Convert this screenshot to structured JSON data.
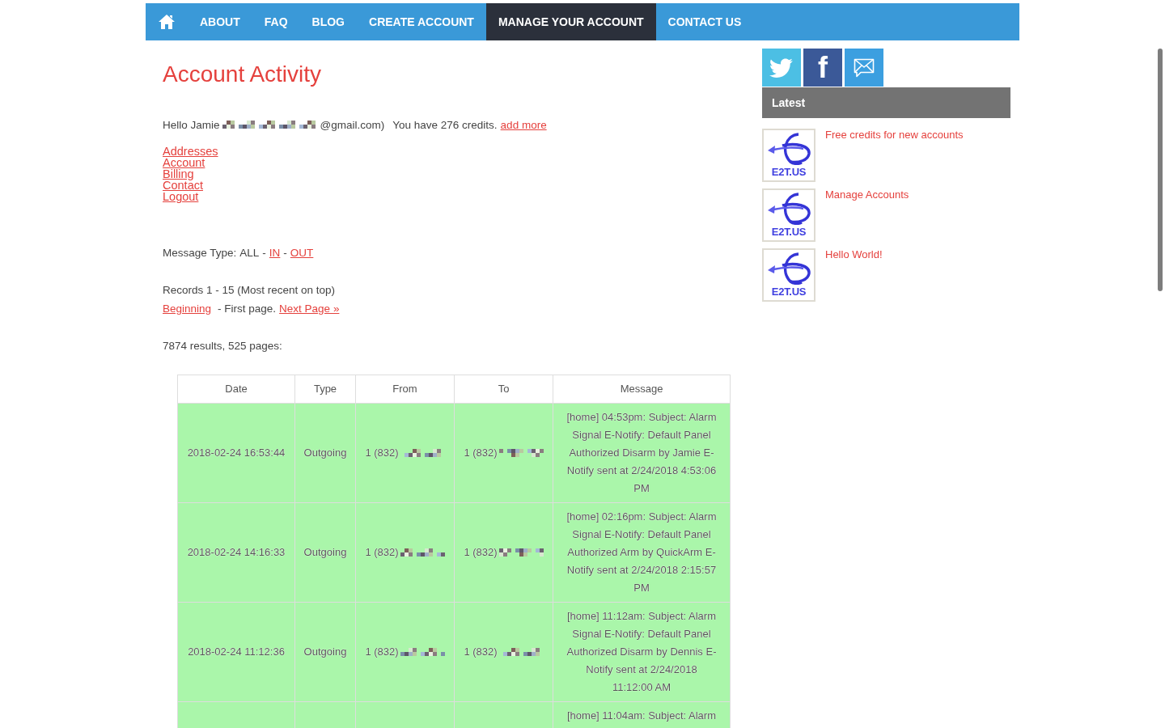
{
  "nav": {
    "items": [
      {
        "kind": "home",
        "selected": false
      },
      {
        "kind": "link",
        "label": "ABOUT",
        "selected": false
      },
      {
        "kind": "link",
        "label": "FAQ",
        "selected": false
      },
      {
        "kind": "link",
        "label": "BLOG",
        "selected": false
      },
      {
        "kind": "link",
        "label": "CREATE ACCOUNT",
        "selected": false
      },
      {
        "kind": "link",
        "label": "MANAGE YOUR ACCOUNT",
        "selected": true
      },
      {
        "kind": "link",
        "label": "CONTACT US",
        "selected": false
      }
    ]
  },
  "main": {
    "title": "Account Activity",
    "greeting": {
      "text": "Hello Jamie",
      "email_redacted": true,
      "email_end": "@gmail.com)",
      "credits": "You have 276 credits.",
      "add_link": "add more"
    },
    "account_links": [
      "Addresses",
      "Account",
      "Billing",
      "Contact",
      "Logout"
    ],
    "message_type": {
      "label": "Message Type:",
      "options": [
        {
          "label": "ALL",
          "selected": true
        },
        {
          "separator": "-",
          "label": "IN",
          "selected": false
        },
        {
          "separator": "-",
          "label": "OUT",
          "selected": false
        }
      ]
    },
    "records": "Records 1 - 15 (Most recent on top)",
    "pager": [
      {
        "kind": "link",
        "text": "Beginning"
      },
      {
        "kind": "text",
        "text": "- First page."
      },
      {
        "kind": "link",
        "text": "Next Page »"
      }
    ],
    "results": "7874 results, 525 pages:"
  },
  "table": {
    "columns": [
      "Date",
      "Type",
      "From",
      "To",
      "Message"
    ],
    "rows": [
      {
        "date": "2018-02-24 16:53:44",
        "type": "Outgoing",
        "from": {
          "text": "1 (832)",
          "redacted": true
        },
        "to": {
          "text": "1 (832)",
          "redacted": true
        },
        "message": "[home] 04:53pm: Subject: Alarm Signal E-Notify: Default Panel Authorized Disarm by Jamie E-Notify sent at 2/24/2018 4:53:06 PM"
      },
      {
        "date": "2018-02-24 14:16:33",
        "type": "Outgoing",
        "from": {
          "text": "1 (832)",
          "redacted": true
        },
        "to": {
          "text": "1 (832)",
          "redacted": true
        },
        "message": "[home] 02:16pm: Subject: Alarm Signal E-Notify: Default Panel Authorized Arm by QuickArm E-Notify sent at 2/24/2018 2:15:57 PM"
      },
      {
        "date": "2018-02-24 11:12:36",
        "type": "Outgoing",
        "from": {
          "text": "1 (832)",
          "redacted": true
        },
        "to": {
          "text": "1 (832)",
          "redacted": true
        },
        "message": "[home] 11:12am: Subject: Alarm Signal E-Notify: Default Panel Authorized Disarm by Dennis E-Notify sent at 2/24/2018 11:12:00 AM"
      },
      {
        "message": "[home] 11:04am: Subject: Alarm"
      }
    ]
  },
  "sidebar": {
    "social": [
      {
        "kind": "twitter"
      },
      {
        "kind": "facebook",
        "label": "f"
      },
      {
        "kind": "email"
      }
    ],
    "latest": {
      "title": "Latest",
      "posts": [
        {
          "title": "Free credits for new accounts",
          "logo_text": "E2T.US"
        },
        {
          "title": "Manage Accounts",
          "logo_text": "E2T.US"
        },
        {
          "title": "Hello World!",
          "logo_text": "E2T.US"
        }
      ]
    }
  }
}
